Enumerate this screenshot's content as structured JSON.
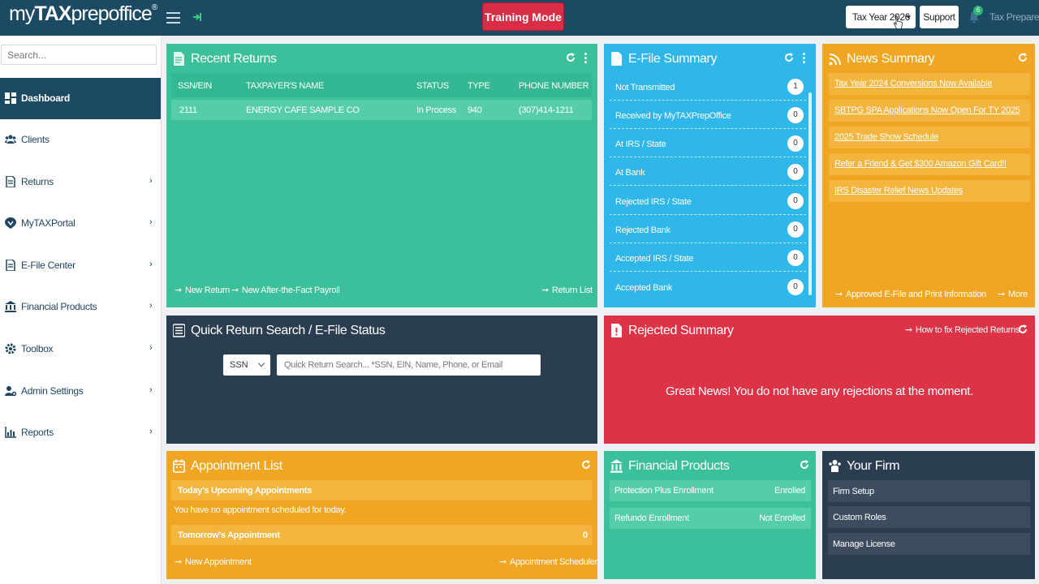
{
  "header": {
    "logo_pre": "my",
    "logo_bold": "TAX",
    "logo_post": "prepoffice",
    "logo_mark": "®",
    "training_mode": "Training Mode",
    "tax_year": "Tax Year 2026",
    "support": "Support",
    "notification_count": "6",
    "user_role": "Tax Preparer"
  },
  "sidebar": {
    "search_placeholder": "Search...",
    "items": [
      {
        "label": "Dashboard",
        "icon": "dashboard-icon"
      },
      {
        "label": "Clients",
        "icon": "users-icon"
      },
      {
        "label": "Returns",
        "icon": "file-icon"
      },
      {
        "label": "MyTAXPortal",
        "icon": "portal-icon"
      },
      {
        "label": "E-File Center",
        "icon": "file-icon"
      },
      {
        "label": "Financial Products",
        "icon": "bank-icon"
      },
      {
        "label": "Toolbox",
        "icon": "gear-icon"
      },
      {
        "label": "Admin Settings",
        "icon": "user-gear-icon"
      },
      {
        "label": "Reports",
        "icon": "bar-chart-icon"
      }
    ]
  },
  "recent_returns": {
    "title": "Recent Returns",
    "columns": [
      "SSN/EIN",
      "TAXPAYER'S NAME",
      "STATUS",
      "TYPE",
      "PHONE NUMBER"
    ],
    "rows": [
      {
        "ssn": "2111",
        "name": "ENERGY CAFE SAMPLE CO",
        "status": "In Process",
        "type": "940",
        "phone": "(307)414-1211"
      }
    ],
    "links": {
      "new_return": "New Return",
      "new_payroll": "New After-the-Fact Payroll",
      "return_list": "Return List"
    }
  },
  "efile_summary": {
    "title": "E-File Summary",
    "rows": [
      {
        "label": "Not Transmitted",
        "count": "1"
      },
      {
        "label": "Received by MyTAXPrepOffice",
        "count": "0"
      },
      {
        "label": "At IRS / State",
        "count": "0"
      },
      {
        "label": "At Bank",
        "count": "0"
      },
      {
        "label": "Rejected IRS / State",
        "count": "0"
      },
      {
        "label": "Rejected Bank",
        "count": "0"
      },
      {
        "label": "Accepted IRS / State",
        "count": "0"
      },
      {
        "label": "Accepted Bank",
        "count": "0"
      }
    ]
  },
  "news_summary": {
    "title": "News Summary",
    "items": [
      "Tax Year 2024 Conversions Now Available",
      "SBTPG SPA Applications Now Open For TY 2025",
      "2025 Trade Show Schedule",
      "Refer a Friend & Get $300 Amazon Gift Card!!",
      "IRS Disaster Relief News Updates"
    ],
    "footer_link": "Approved E-File and Print Information",
    "more": "More"
  },
  "quick_search": {
    "title": "Quick Return Search / E-File Status",
    "select_value": "SSN",
    "placeholder": "Quick Return Search... *SSN, EIN, Name, Phone, or Email"
  },
  "rejected_summary": {
    "title": "Rejected Summary",
    "how_to_fix": "How to fix Rejected Returns",
    "message": "Great News! You do not have any rejections at the moment."
  },
  "appointments": {
    "title": "Appointment List",
    "today_header": "Today's Upcoming Appointments",
    "today_message": "You have no appointment scheduled for today.",
    "tomorrow_header": "Tomorrow's Appointment",
    "tomorrow_count": "0",
    "new_appointment": "New Appointment",
    "scheduler": "Appointment Scheduler"
  },
  "financial_products": {
    "title": "Financial Products",
    "rows": [
      {
        "label": "Protection Plus Enrollment",
        "status": "Enrolled"
      },
      {
        "label": "Refundo Enrollment",
        "status": "Not Enrolled"
      }
    ]
  },
  "your_firm": {
    "title": "Your Firm",
    "items": [
      "Firm Setup",
      "Custom Roles",
      "Manage License"
    ]
  },
  "colors": {
    "header": "#1b4a62",
    "green": "#3cc09c",
    "blue": "#2fb7ea",
    "amber": "#f1a623",
    "dark": "#2b3d51",
    "red": "#dd3347"
  }
}
